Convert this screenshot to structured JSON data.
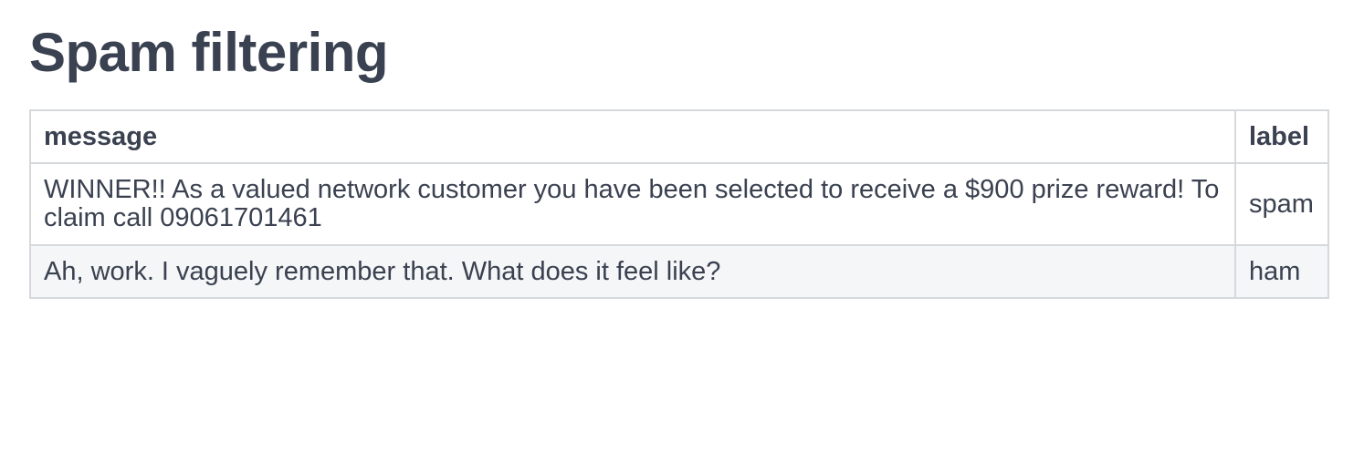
{
  "title": "Spam filtering",
  "table": {
    "headers": [
      "message",
      "label"
    ],
    "rows": [
      {
        "message": "WINNER!! As a valued network customer you have been selected to receive a $900 prize reward! To claim call 09061701461",
        "label": "spam"
      },
      {
        "message": "Ah, work. I vaguely remember that. What does it feel like?",
        "label": "ham"
      }
    ]
  },
  "colors": {
    "text": "#3a4150",
    "border": "#d6d9dc",
    "striped_row": "#f4f6f7",
    "background": "#ffffff"
  }
}
